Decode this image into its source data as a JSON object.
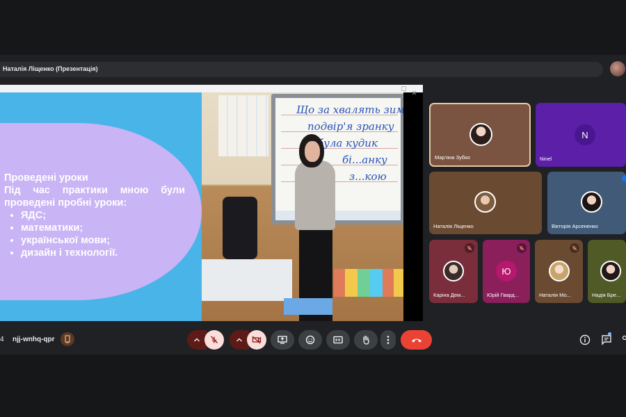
{
  "presenter_bar": {
    "title": "Наталія Ліщенко (Презентація)"
  },
  "slide": {
    "heading": "Проведені уроки",
    "body": "Під час практики мною були проведені пробні уроки:",
    "bullets": [
      "ЯДС;",
      "математики;",
      "української мови;",
      "дизайн і технології."
    ],
    "board_lines": [
      "Що за хвалять зими",
      "подвір'я зранку",
      "була кудик",
      "бі...анку",
      "з...кою"
    ]
  },
  "participants": [
    {
      "name": "Мар'яна Зубко",
      "bg": "#7a5440",
      "highlight": true,
      "muted": false
    },
    {
      "name": "Ninel",
      "bg": "#5b1fa8",
      "initial": "N",
      "initial_bg": "#4a168f",
      "muted": false
    },
    {
      "name": "Наталія Ліщенко",
      "bg": "#6b4a32",
      "muted": false
    },
    {
      "name": "Вікторія Арсененко",
      "bg": "#405a78",
      "muted": false
    },
    {
      "name": "Каріна Дем...",
      "bg": "#7a2e3b",
      "muted": true
    },
    {
      "name": "Юрій Гвард...",
      "bg": "#8a1f5c",
      "initial": "Ю",
      "initial_bg": "#b5186c",
      "muted": true
    },
    {
      "name": "Наталія Мо...",
      "bg": "#6b4a32",
      "muted": true
    },
    {
      "name": "Надія Бре...",
      "bg": "#4f5a26",
      "muted": true
    }
  ],
  "meeting": {
    "code": "njj-wnhq-qpr",
    "left_fragment": "4"
  },
  "colors": {
    "end_call": "#ea4335",
    "muted_pink": "#f9dedc",
    "accent_blue": "#8ab4f8"
  }
}
